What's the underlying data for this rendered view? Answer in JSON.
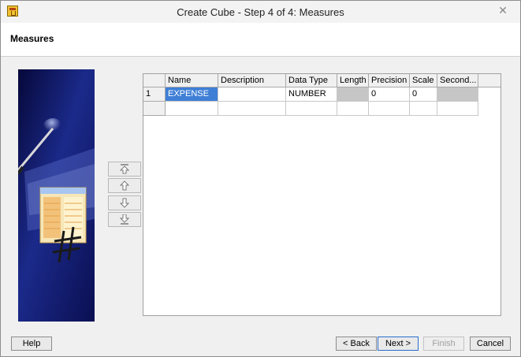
{
  "window": {
    "title": "Create Cube - Step 4 of 4: Measures",
    "close_label": "✕"
  },
  "header": {
    "title": "Measures"
  },
  "grid": {
    "columns": [
      "",
      "Name",
      "Description",
      "Data Type",
      "Length",
      "Precision",
      "Scale",
      "Second..."
    ],
    "rows": [
      [
        "1",
        "EXPENSE",
        "",
        "NUMBER",
        "",
        "0",
        "0",
        ""
      ],
      [
        "",
        "",
        "",
        "",
        "",
        "",
        "",
        ""
      ]
    ]
  },
  "move_buttons": {
    "top": "arrow-up-to-top-icon",
    "up": "arrow-up-icon",
    "down": "arrow-down-icon",
    "bottom": "arrow-down-to-bottom-icon"
  },
  "footer": {
    "help": "Help",
    "back": "< Back",
    "next": "Next >",
    "finish": "Finish",
    "cancel": "Cancel"
  }
}
